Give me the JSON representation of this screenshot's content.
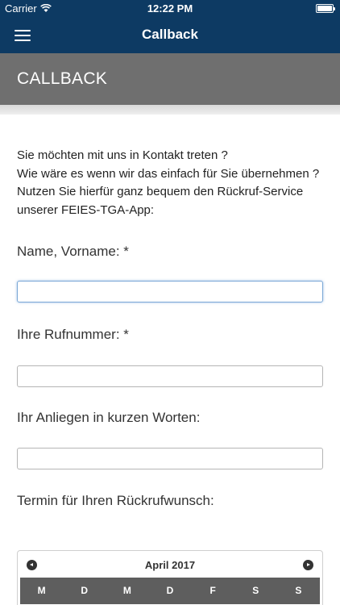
{
  "status_bar": {
    "carrier": "Carrier",
    "time": "12:22 PM"
  },
  "nav": {
    "title": "Callback"
  },
  "header": {
    "title": "CALLBACK"
  },
  "intro": {
    "lines": [
      "Sie möchten mit uns in Kontakt treten ?",
      "Wie wäre es wenn wir das einfach für Sie übernehmen ?",
      "Nutzen Sie hierfür ganz bequem den Rückruf-Service unserer FEIES-TGA-App:"
    ]
  },
  "form": {
    "name_label": "Name, Vorname: *",
    "name_value": "",
    "phone_label": "Ihre Rufnummer: *",
    "phone_value": "",
    "concern_label": "Ihr Anliegen in kurzen Worten:",
    "concern_value": "",
    "date_label": "Termin für Ihren Rückrufwunsch:"
  },
  "calendar": {
    "month": "April 2017",
    "weekdays": [
      "M",
      "D",
      "M",
      "D",
      "F",
      "S",
      "S"
    ]
  },
  "colors": {
    "nav_bg": "#0d3a63",
    "header_bg": "#6f6f6f",
    "weekday_bg": "#5e5e5e"
  }
}
